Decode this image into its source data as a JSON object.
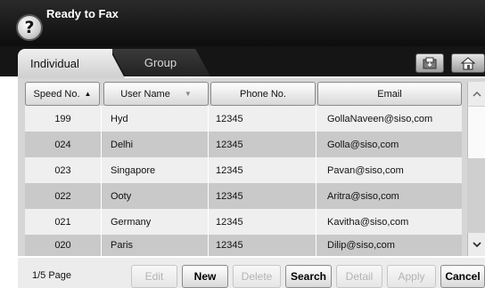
{
  "header": {
    "title": "Ready to Fax",
    "help_symbol": "?"
  },
  "tabs": [
    {
      "label": "Individual",
      "selected": true
    },
    {
      "label": "Group",
      "selected": false
    }
  ],
  "toolbar_icons": [
    "address-book-icon",
    "home-icon"
  ],
  "table": {
    "columns": [
      {
        "label": "Speed No.",
        "sort": "ascending",
        "sort_symbol": "▲"
      },
      {
        "label": "User Name",
        "sort": "dropdown",
        "sort_symbol": "▼"
      },
      {
        "label": "Phone No."
      },
      {
        "label": "Email"
      }
    ],
    "rows": [
      {
        "speed": "199",
        "name": "Hyd",
        "phone": "12345",
        "email": "GollaNaveen@siso,com"
      },
      {
        "speed": "024",
        "name": "Delhi",
        "phone": "12345",
        "email": "Golla@siso,com"
      },
      {
        "speed": "023",
        "name": "Singapore",
        "phone": "12345",
        "email": "Pavan@siso,com"
      },
      {
        "speed": "022",
        "name": "Ooty",
        "phone": "12345",
        "email": "Aritra@siso,com"
      },
      {
        "speed": "021",
        "name": "Germany",
        "phone": "12345",
        "email": "Kavitha@siso,com"
      },
      {
        "speed": "020",
        "name": "Paris",
        "phone": "12345",
        "email": "Dilip@siso,com"
      }
    ]
  },
  "footer": {
    "page_label": "1/5 Page",
    "buttons": [
      {
        "label": "Edit",
        "enabled": false
      },
      {
        "label": "New",
        "enabled": true
      },
      {
        "label": "Delete",
        "enabled": false
      },
      {
        "label": "Search",
        "enabled": true
      },
      {
        "label": "Detail",
        "enabled": false
      },
      {
        "label": "Apply",
        "enabled": false
      },
      {
        "label": "Cancel",
        "enabled": true
      }
    ]
  }
}
